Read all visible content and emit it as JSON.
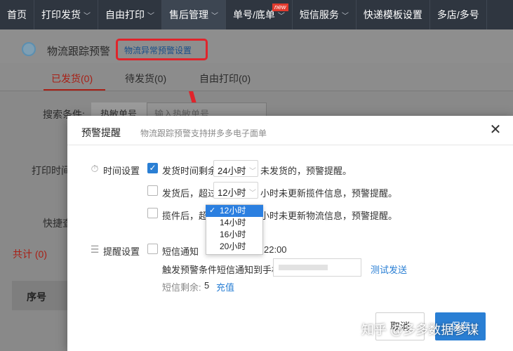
{
  "nav": {
    "items": [
      {
        "label": "首页",
        "chev": false
      },
      {
        "label": "打印发货",
        "chev": true
      },
      {
        "label": "自由打印",
        "chev": true
      },
      {
        "label": "售后管理",
        "chev": true
      },
      {
        "label": "单号/底单",
        "chev": true
      },
      {
        "label": "短信服务",
        "chev": true
      },
      {
        "label": "快递模板设置",
        "chev": false
      },
      {
        "label": "多店/多号",
        "chev": false
      }
    ],
    "new_badge": "new"
  },
  "page": {
    "title": "物流跟踪预警",
    "alert_link": "物流异常预警设置",
    "tabs": [
      "已发货(0)",
      "待发货(0)",
      "自由打印(0)"
    ],
    "search_label": "搜索条件:",
    "search_segment": "热敏单号",
    "search_placeholder": "输入热敏单号",
    "print_time_label": "打印时间",
    "quick_label": "快捷查",
    "total_label": "共计 (0)",
    "table_col_index": "序号"
  },
  "modal": {
    "title": "预警提醒",
    "subtitle": "物流跟踪预警支持拼多多电子面单",
    "close_icon": "close-icon",
    "time_section": {
      "label": "时间设置",
      "rules": [
        {
          "checked": true,
          "prefix": "发货时间剩余",
          "select": "24小时",
          "suffix": "未发货的，预警提醒。"
        },
        {
          "checked": false,
          "prefix": "发货后，超过",
          "select": "12小时",
          "suffix": "小时未更新揽件信息，预警提醒。"
        },
        {
          "checked": false,
          "prefix": "揽件后，超过",
          "select": "12小时",
          "suffix": "小时未更新物流信息，预警提醒。"
        }
      ],
      "dropdown_options": [
        "12小时",
        "14小时",
        "16小时",
        "20小时"
      ],
      "dropdown_selected": "12小时"
    },
    "remind_section": {
      "label": "提醒设置",
      "sms_label": "短信通知",
      "sms_time_tail": "22:00",
      "phone_label": "触发预警条件短信通知到手机",
      "test_send": "测试发送",
      "sms_remaining_label": "短信剩余:",
      "sms_remaining_value": "5",
      "recharge": "充值"
    },
    "cancel_label": "取消",
    "save_label": "保存"
  },
  "watermark": "知乎 @多多数据参谋",
  "colors": {
    "accent_blue": "#2a7fd4",
    "highlight_red": "#e0242b",
    "nav_bg": "#2f3640"
  }
}
